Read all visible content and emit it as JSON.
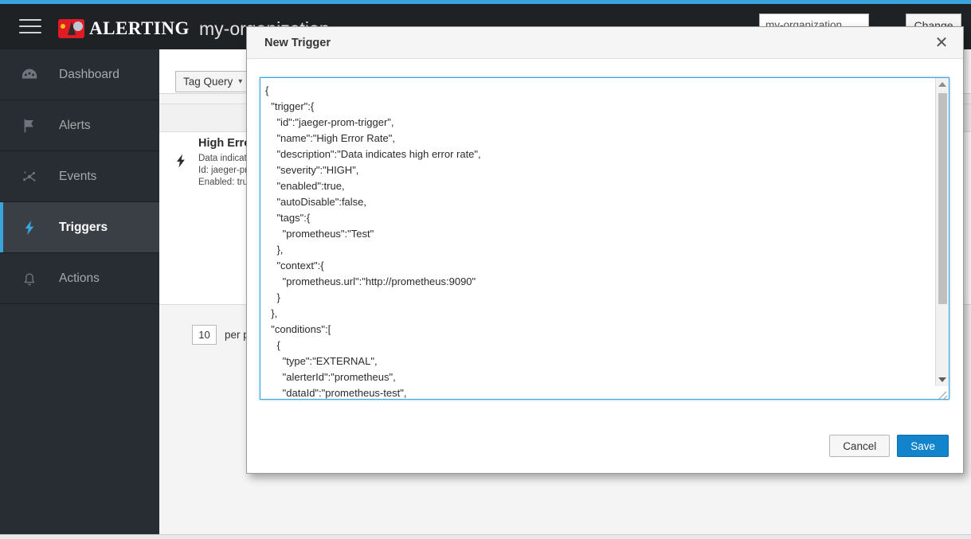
{
  "theme": {
    "accent_blue": "#39a5dc",
    "sidebar_bg": "#282d33",
    "header_bg": "#1f2225",
    "save_button_blue": "#1184cb",
    "logo_red": "#e01b24"
  },
  "header": {
    "menu_icon": "hamburger-menu-icon",
    "logo_icon": "hawkular-logo-icon",
    "brand": "ALERTING",
    "organization": "my-organization",
    "org_input_value": "my-organization",
    "change_label": "Change"
  },
  "sidebar": {
    "items": [
      {
        "label": "Dashboard",
        "icon": "dashboard-gauge-icon",
        "active": false
      },
      {
        "label": "Alerts",
        "icon": "flag-icon",
        "active": false
      },
      {
        "label": "Events",
        "icon": "topology-nodes-icon",
        "active": false
      },
      {
        "label": "Triggers",
        "icon": "lightning-bolt-icon",
        "active": true
      },
      {
        "label": "Actions",
        "icon": "bell-icon",
        "active": false
      }
    ]
  },
  "content": {
    "tag_query_label": "Tag Query",
    "tag_query_chevron": "chevron-down-icon",
    "trigger_row": {
      "icon": "lightning-bolt-icon",
      "title": "High Error Rate",
      "description": "Data indicates high error rate",
      "id_line": "Id: jaeger-prom-trigger",
      "enabled_line": "Enabled: true"
    },
    "pager": {
      "per_page_value": "10",
      "per_page_label": "per page"
    }
  },
  "modal": {
    "title": "New Trigger",
    "close_icon": "close-icon",
    "json_value": "{\n  \"trigger\":{\n    \"id\":\"jaeger-prom-trigger\",\n    \"name\":\"High Error Rate\",\n    \"description\":\"Data indicates high error rate\",\n    \"severity\":\"HIGH\",\n    \"enabled\":true,\n    \"autoDisable\":false,\n    \"tags\":{\n      \"prometheus\":\"Test\"\n    },\n    \"context\":{\n      \"prometheus.url\":\"http://prometheus:9090\"\n    }\n  },\n  \"conditions\":[\n    {\n      \"type\":\"EXTERNAL\",\n      \"alerterId\":\"prometheus\",\n      \"dataId\":\"prometheus-test\",",
    "scrollbar": {
      "up_icon": "scroll-up-arrow-icon",
      "down_icon": "scroll-down-arrow-icon",
      "thumb": "scrollbar-thumb"
    },
    "resize_handle": "resize-grip-icon",
    "cancel_label": "Cancel",
    "save_label": "Save"
  }
}
